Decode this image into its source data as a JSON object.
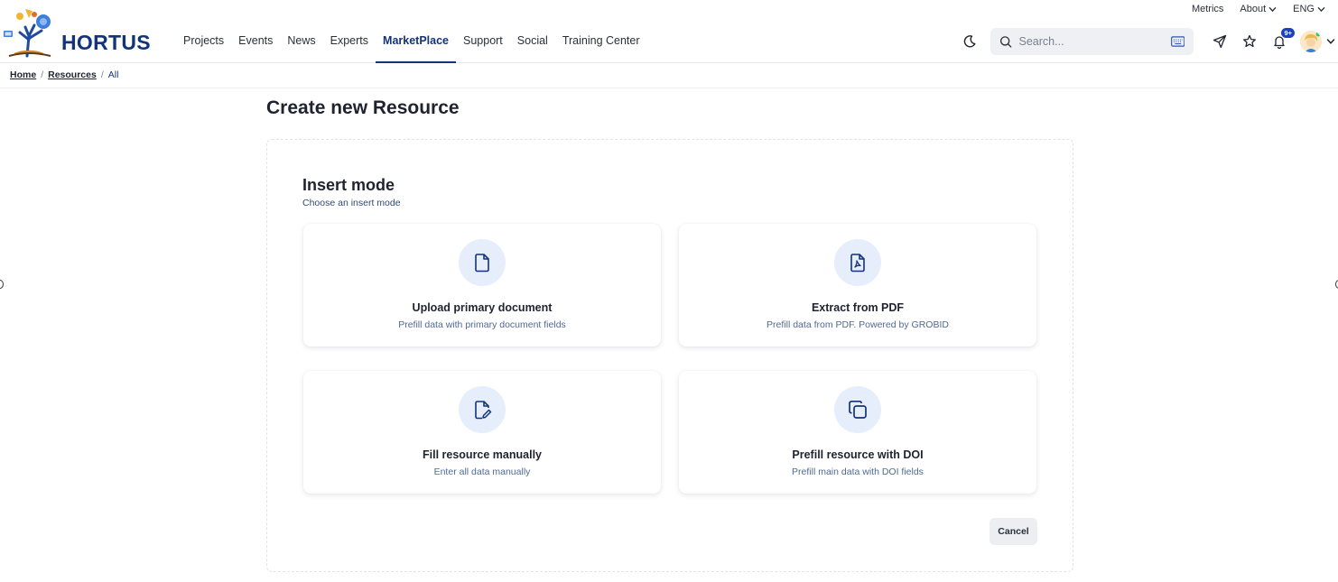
{
  "utility_bar": {
    "metrics": "Metrics",
    "about": "About",
    "language": "ENG"
  },
  "brand": {
    "name": "HORTUS"
  },
  "nav": {
    "items": [
      "Projects",
      "Events",
      "News",
      "Experts",
      "MarketPlace",
      "Support",
      "Social",
      "Training Center"
    ],
    "active": "MarketPlace"
  },
  "search": {
    "placeholder": "Search..."
  },
  "notifications": {
    "badge": "9+"
  },
  "breadcrumb": {
    "home": "Home",
    "resources": "Resources",
    "current": "All",
    "separator": "/"
  },
  "page": {
    "title": "Create new Resource",
    "section_title": "Insert mode",
    "section_subtitle": "Choose an insert mode"
  },
  "cards": [
    {
      "title": "Upload primary document",
      "subtitle": "Prefill data with primary document fields",
      "icon": "file-icon"
    },
    {
      "title": "Extract from PDF",
      "subtitle": "Prefill data from PDF. Powered by GROBID",
      "icon": "pdf-file-icon"
    },
    {
      "title": "Fill resource manually",
      "subtitle": "Enter all data manually",
      "icon": "file-edit-icon"
    },
    {
      "title": "Prefill resource with DOI",
      "subtitle": "Prefill main data with DOI fields",
      "icon": "copy-icon"
    }
  ],
  "actions": {
    "cancel": "Cancel"
  },
  "colors": {
    "brand_navy": "#13347a",
    "icon_circle_bg": "#e6edfb",
    "badge_blue": "#1b3fc9"
  }
}
